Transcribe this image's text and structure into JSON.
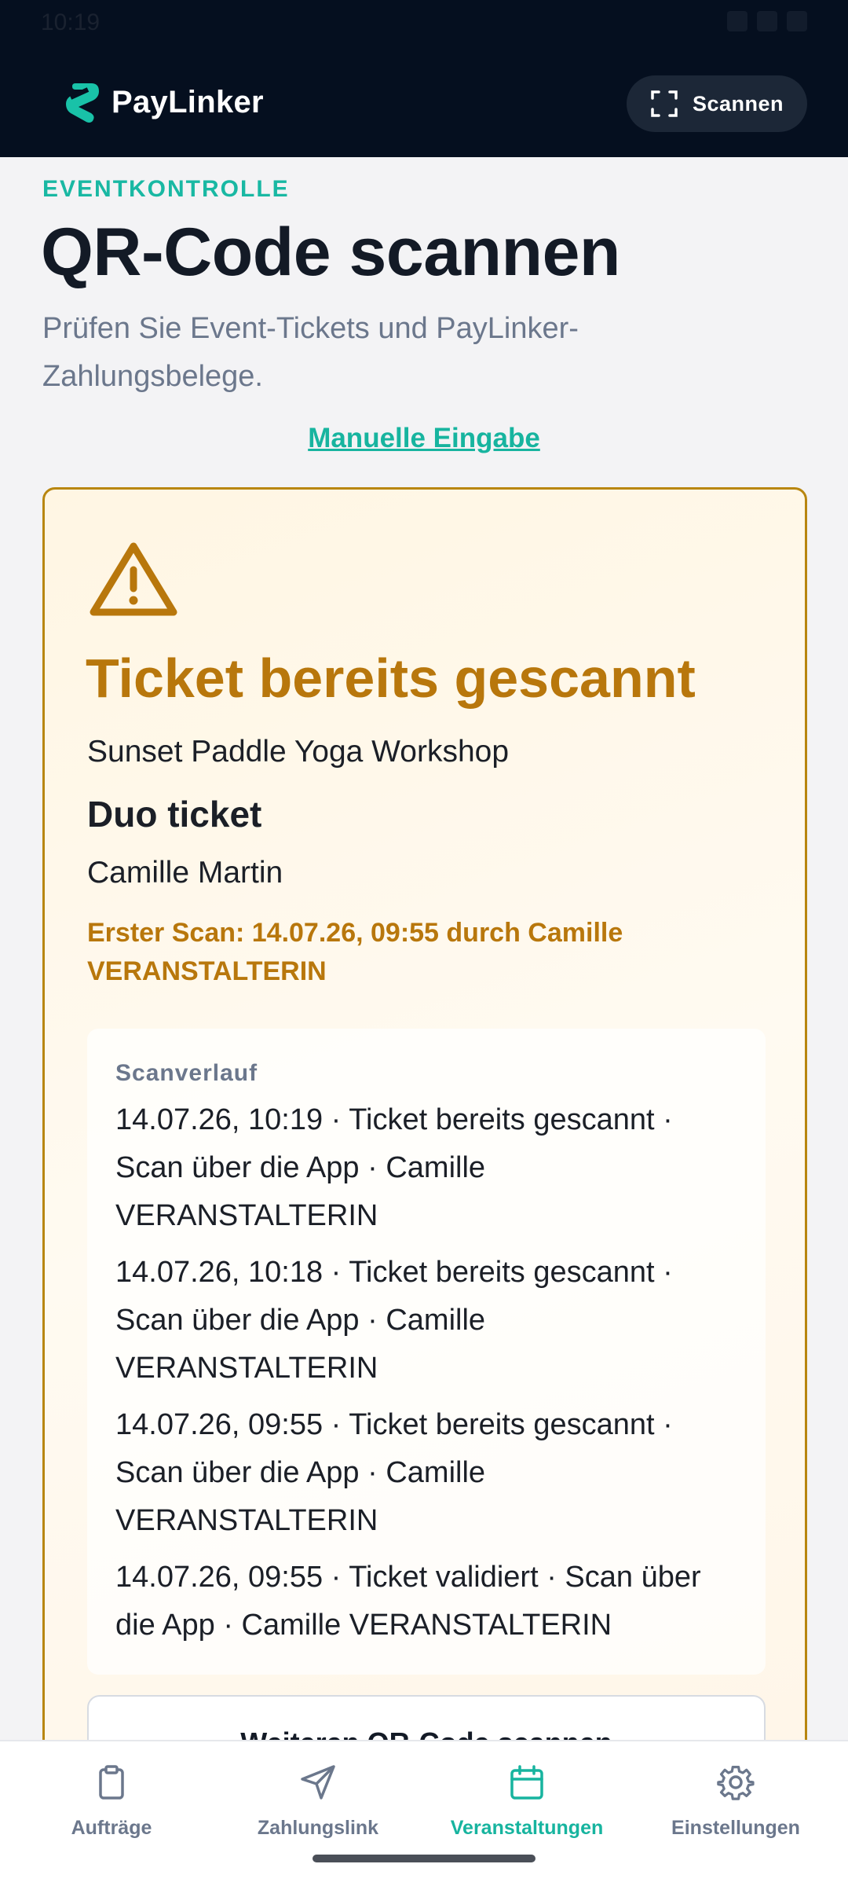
{
  "status_bar": {
    "time": "10:19"
  },
  "header": {
    "brand": "PayLinker",
    "scan_button_label": "Scannen"
  },
  "page": {
    "eyebrow": "EVENTKONTROLLE",
    "title": "QR-Code scannen",
    "subtitle": "Prüfen Sie Event-Tickets und PayLinker-Zahlungsbelege.",
    "manual_link": "Manuelle Eingabe"
  },
  "result": {
    "title": "Ticket bereits gescannt",
    "event": "Sunset Paddle Yoga Workshop",
    "ticket_type": "Duo ticket",
    "holder": "Camille Martin",
    "first_scan": "Erster Scan: 14.07.26, 09:55 durch Camille VERANSTALTERIN",
    "history_title": "Scanverlauf",
    "history": [
      "14.07.26, 10:19 · Ticket bereits gescannt · Scan über die App · Camille VERANSTALTERIN",
      "14.07.26, 10:18 · Ticket bereits gescannt · Scan über die App · Camille VERANSTALTERIN",
      "14.07.26, 09:55 · Ticket bereits gescannt · Scan über die App · Camille VERANSTALTERIN",
      "14.07.26, 09:55 · Ticket validiert · Scan über die App · Camille VERANSTALTERIN"
    ],
    "scan_another_label": "Weiteren QR-Code scannen"
  },
  "nav": {
    "items": [
      {
        "label": "Aufträge",
        "icon": "clipboard-icon"
      },
      {
        "label": "Zahlungslink",
        "icon": "send-icon"
      },
      {
        "label": "Veranstaltungen",
        "icon": "calendar-icon",
        "active": true
      },
      {
        "label": "Einstellungen",
        "icon": "gear-icon"
      }
    ]
  },
  "colors": {
    "header_bg": "#050f1f",
    "accent": "#17b49f",
    "warning": "#b8770c",
    "warning_border": "#b8860f",
    "card_bg": "#fff6e3"
  }
}
